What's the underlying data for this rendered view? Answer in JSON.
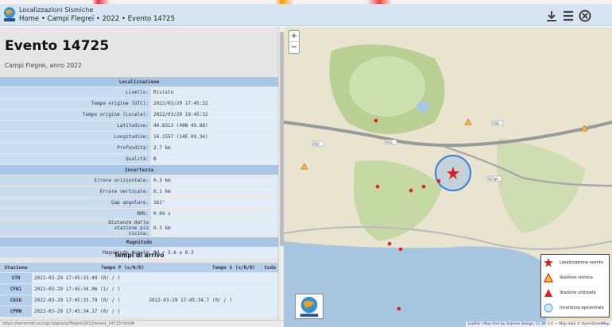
{
  "header": {
    "app_title": "Localizzazioni Sismiche",
    "breadcrumb": [
      "Home",
      "Campi Flegrei",
      "2022",
      "Evento 14725"
    ],
    "sep": "•"
  },
  "event": {
    "title": "Evento 14725",
    "subtitle": "Campi Flegrei, anno 2022"
  },
  "localizzazione": {
    "heading": "Localizzazione",
    "rows": [
      [
        "Livello:",
        "Rivisto"
      ],
      [
        "Tempo origine (UTC):",
        "2022/03/29 17:45:32"
      ],
      [
        "Tempo origine (Locale):",
        "2022/03/29 19:45:32"
      ],
      [
        "Latitudine:",
        "40.8313 (40N 49.88)"
      ],
      [
        "Longitudine:",
        "14.1557 (14E 09.34)"
      ],
      [
        "Profondità:",
        "2.7 km"
      ],
      [
        "Qualità:",
        "B"
      ]
    ]
  },
  "incertezza": {
    "heading": "Incertezza",
    "rows": [
      [
        "Errore orizzontale:",
        "0.3 km"
      ],
      [
        "Errore verticale:",
        "0.1 km"
      ],
      [
        "Gap angolare:",
        "161°"
      ],
      [
        "RMS:",
        "0.09 s"
      ],
      [
        "Distanza dalla stazione più vicina:",
        "0.3 km"
      ]
    ]
  },
  "magnitudo": {
    "heading": "Magnitudo",
    "rows": [
      [
        "Magnitudo durata",
        "Md = 3.6 ± 0.3"
      ]
    ]
  },
  "arrivi": {
    "title": "Tempi di arrivo",
    "columns": [
      "Stazione",
      "Tempo P (s/N/D)",
      "Tempo S (s/N/D)",
      "Coda"
    ],
    "rows": [
      [
        "STH",
        "2022-03-29 17:45:33.49 (0/ / )",
        "",
        ""
      ],
      [
        "CFB1",
        "2022-03-29 17:45:34.06 (1/ / )",
        "",
        ""
      ],
      [
        "CASO",
        "2022-03-29 17:45:33.79 (0/ / )",
        "2022-03-29 17:45:34.7 (0/ / )",
        ""
      ],
      [
        "CPMN",
        "2022-03-29 17:45:34.17 (0/ / )",
        "",
        ""
      ]
    ]
  },
  "status_url": "https://terremoti.ov.ingv.it/gossip/flegrei/2022/event_14725.html#",
  "map": {
    "zoom_in": "+",
    "zoom_out": "−",
    "legend": [
      "Localizzazione evento",
      "Stazione sismica",
      "Stazione utilizzata",
      "Incertezza epicentrale"
    ],
    "attribution": "Leaflet | Map tiles by Stamen Design, CC BY 3.0 — Map data © OpenStreetMap",
    "road_labels": [
      "A56",
      "A56",
      "A56",
      "SS7qtr"
    ]
  },
  "colors": {
    "header_bg": "#d6e4f3",
    "label_bg": "#c9dcf0",
    "value_bg": "#e2ecf7",
    "section_bg": "#a9c6e4",
    "event_star": "#d21f1f",
    "station": "#e02020",
    "uncertainty": "#3b7fd9"
  }
}
